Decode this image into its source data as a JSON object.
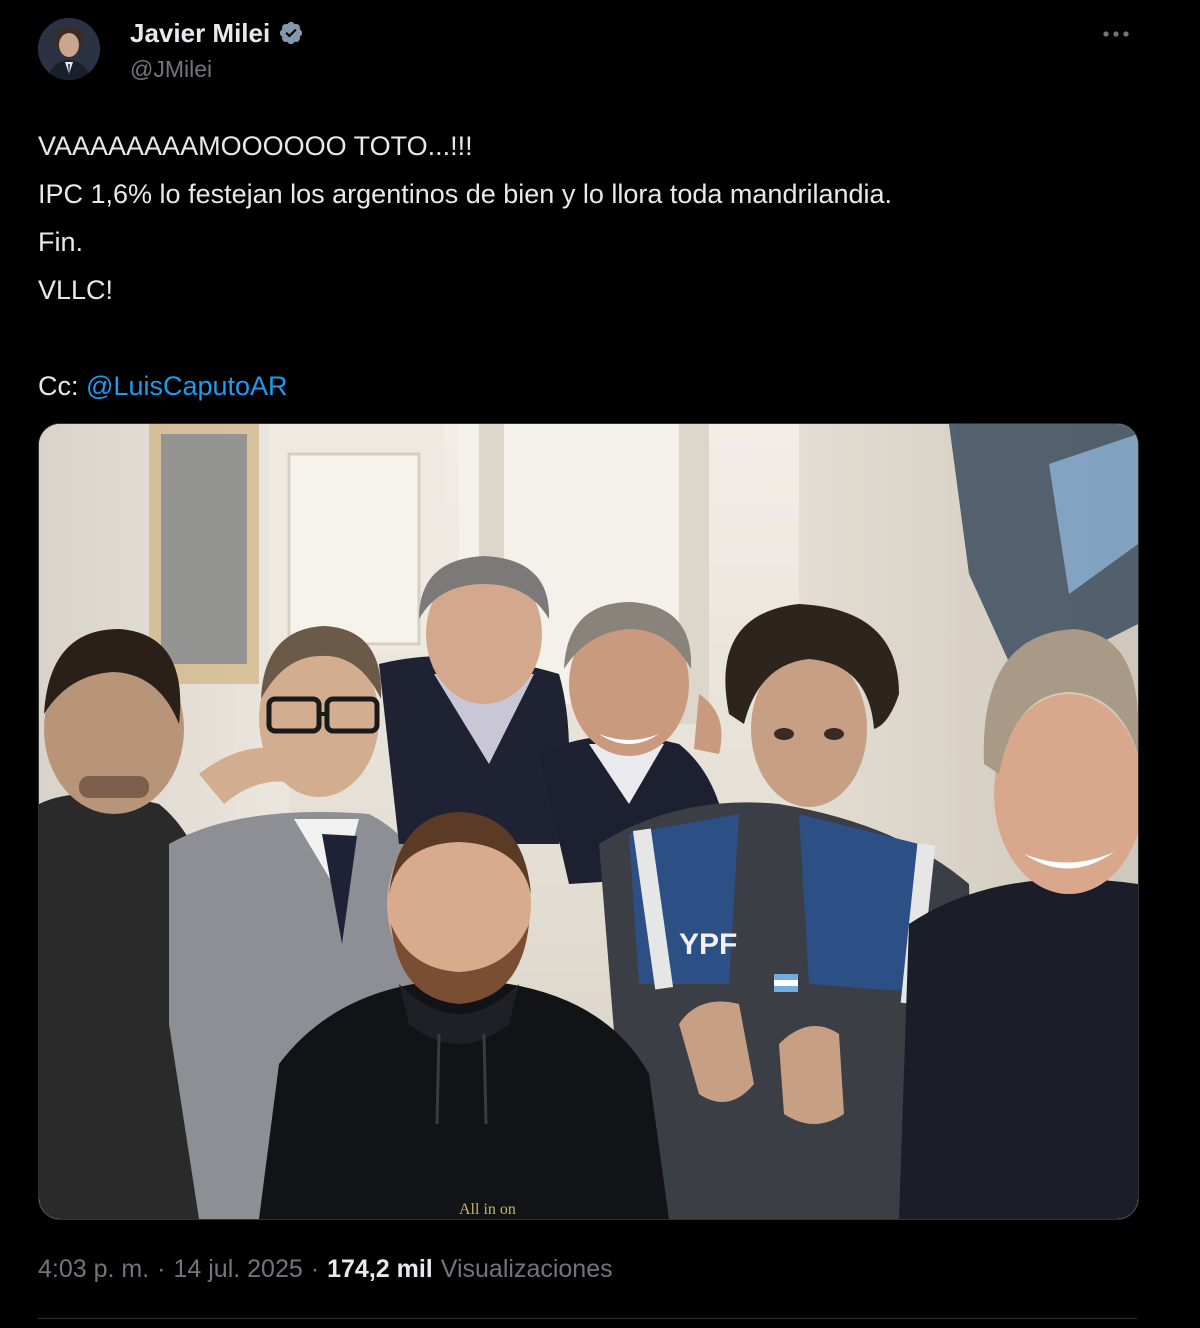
{
  "author": {
    "display_name": "Javier Milei",
    "handle": "@JMilei",
    "verified": true
  },
  "more_icon": "more-horizontal-icon",
  "tweet": {
    "lines": [
      "VAAAAAAAAMOOOOOO TOTO...!!!",
      "IPC 1,6% lo festejan los argentinos de bien y lo llora toda mandrilandia.",
      "Fin.",
      "VLLC!"
    ],
    "cc_label": "Cc: ",
    "mention": "@LuisCaputoAR"
  },
  "media": {
    "jacket_text": "YPF",
    "shirt_text": "All in on"
  },
  "meta": {
    "time": "4:03 p. m.",
    "separator": "·",
    "date": "14 jul. 2025",
    "views_count": "174,2 mil",
    "views_label": "Visualizaciones"
  },
  "colors": {
    "background": "#000000",
    "text": "#e7e9ea",
    "secondary": "#71767b",
    "link": "#1d9bf0",
    "verified": "#829aab"
  }
}
